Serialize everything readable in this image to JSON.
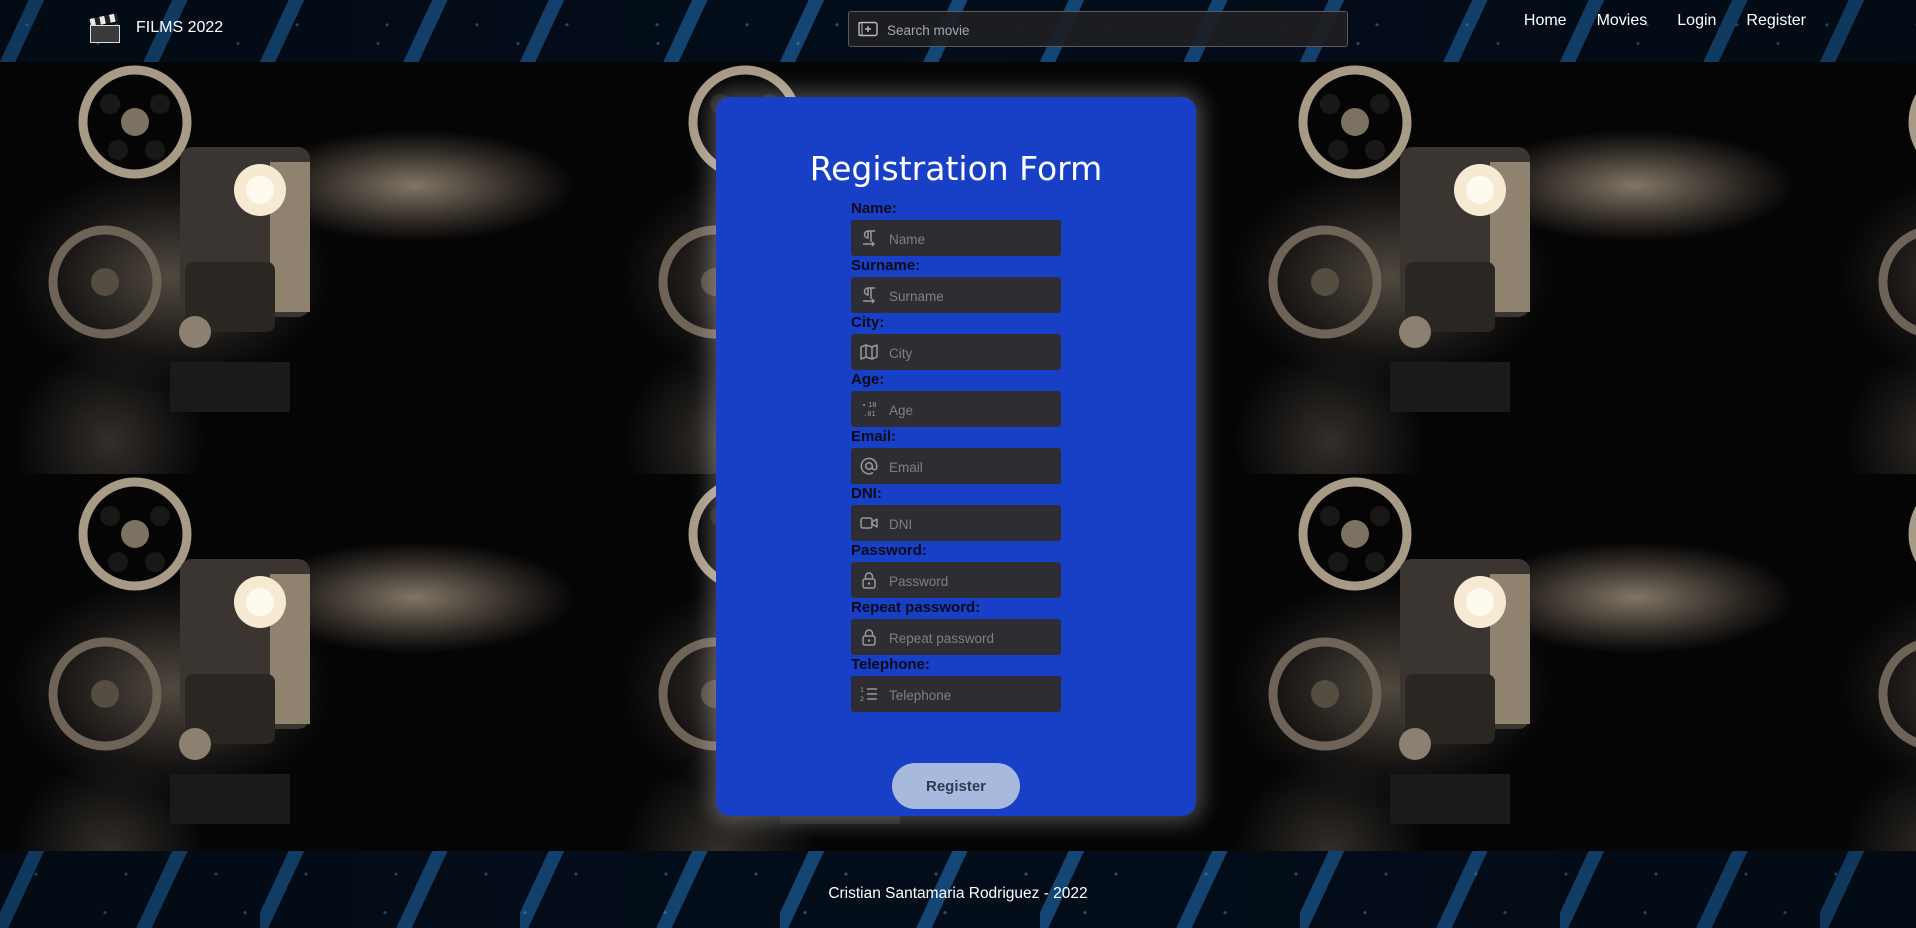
{
  "header": {
    "brand": "FILMS 2022",
    "search_placeholder": "Search movie",
    "nav": [
      "Home",
      "Movies",
      "Login",
      "Register"
    ]
  },
  "form": {
    "title": "Registration Form",
    "fields": [
      {
        "label": "Name:",
        "placeholder": "Name",
        "icon": "paragraph-icon"
      },
      {
        "label": "Surname:",
        "placeholder": "Surname",
        "icon": "paragraph-icon"
      },
      {
        "label": "City:",
        "placeholder": "City",
        "icon": "map-icon"
      },
      {
        "label": "Age:",
        "placeholder": "Age",
        "icon": "number-icon"
      },
      {
        "label": "Email:",
        "placeholder": "Email",
        "icon": "at-icon"
      },
      {
        "label": "DNI:",
        "placeholder": "DNI",
        "icon": "video-icon"
      },
      {
        "label": "Password:",
        "placeholder": "Password",
        "icon": "lock-icon"
      },
      {
        "label": "Repeat password:",
        "placeholder": "Repeat password",
        "icon": "lock-icon"
      },
      {
        "label": "Telephone:",
        "placeholder": "Telephone",
        "icon": "list-numbered-icon"
      }
    ],
    "submit_label": "Register"
  },
  "footer": {
    "text": "Cristian Santamaria Rodriguez - 2022"
  },
  "colors": {
    "card": "#1740c6",
    "input_bg": "#2d2d33",
    "button_bg": "#a7b9dd",
    "label_text": "#0b0b18"
  }
}
